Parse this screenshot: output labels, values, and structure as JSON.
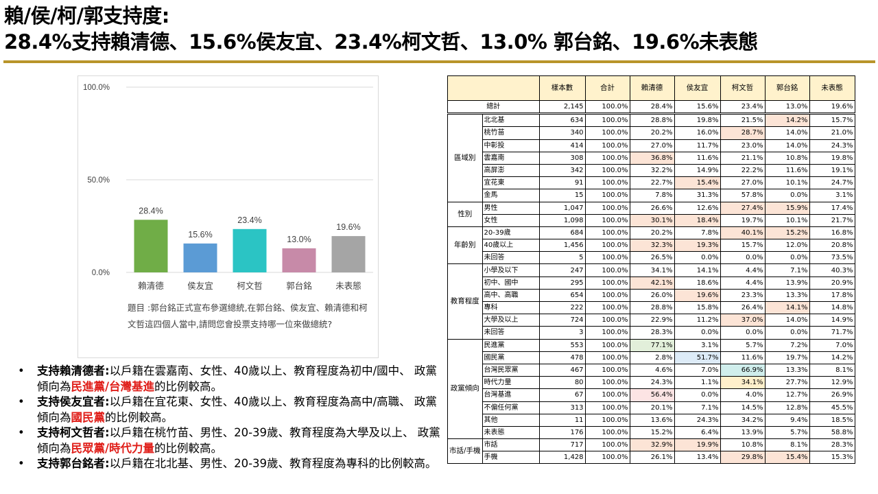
{
  "title": {
    "line1": "賴/侯/柯/郭支持度:",
    "line2": "28.4%支持賴清德、15.6%侯友宜、23.4%柯文哲、13.0% 郭台銘、19.6%未表態"
  },
  "colors": {
    "rule": "#B8942A",
    "highlight_text": "#E0201B",
    "table_header": "#FFF2CC"
  },
  "chart_data": {
    "type": "bar",
    "categories": [
      "賴清德",
      "侯友宜",
      "柯文哲",
      "郭台銘",
      "未表態"
    ],
    "values": [
      28.4,
      15.6,
      23.4,
      13.0,
      19.6
    ],
    "value_labels": [
      "28.4%",
      "15.6%",
      "23.4%",
      "13.0%",
      "19.6%"
    ],
    "bar_colors": [
      "#70AD47",
      "#5B9BD5",
      "#2BC4C4",
      "#C78AA8",
      "#A5A5A5"
    ],
    "yticks": [
      0,
      50,
      100
    ],
    "ytick_labels": [
      "0.0%",
      "50.0%",
      "100.0%"
    ],
    "ylim": [
      0,
      100
    ],
    "grid": true,
    "title": "",
    "xlabel": "",
    "ylabel": "",
    "note": "題目 :郭台銘正式宣布參選總統,在郭台銘、侯友宜、賴清德和柯文哲這四個人當中,請問您會投票支持哪一位來做總統?"
  },
  "bullets": [
    {
      "lead": "支持賴清德者:",
      "pre": "以戶籍在雲嘉南、女性、40歲以上、教育程度為初中/國中、 政黨傾向為",
      "hl": "民進黨/台灣基進",
      "post": "的比例較高。"
    },
    {
      "lead": "支持侯友宜者:",
      "pre": "以戶籍在宜花東、女性、40歲以上、教育程度為高中/高職、 政黨傾向為",
      "hl": "國民黨",
      "post": "的比例較高。"
    },
    {
      "lead": "支持柯文哲者:",
      "pre": "以戶籍在桃竹苗、男性、20-39歲、教育程度為大學及以上、 政黨傾向為",
      "hl": "民眾黨/時代力量",
      "post": "的比例較高。"
    },
    {
      "lead": "支持郭台銘者:",
      "pre": "以戶籍在北北基、男性、20-39歲、教育程度為專科的比例較高。",
      "hl": "",
      "post": ""
    }
  ],
  "table": {
    "headers": [
      "",
      "樣本數",
      "合計",
      "賴清德",
      "侯友宜",
      "柯文哲",
      "郭台銘",
      "未表態"
    ],
    "total": {
      "label": "總計",
      "values": [
        "2,145",
        "100.0%",
        "28.4%",
        "15.6%",
        "23.4%",
        "13.0%",
        "19.6%"
      ]
    },
    "groups": [
      {
        "name": "區域別",
        "rows": [
          {
            "label": "北北基",
            "values": [
              "634",
              "100.0%",
              "28.8%",
              "19.8%",
              "21.5%",
              "14.2%",
              "15.7%"
            ],
            "hl": [
              null,
              null,
              null,
              null,
              null,
              "pink",
              null
            ]
          },
          {
            "label": "桃竹苗",
            "values": [
              "340",
              "100.0%",
              "20.2%",
              "16.0%",
              "28.7%",
              "14.0%",
              "21.0%"
            ],
            "hl": [
              null,
              null,
              null,
              null,
              "pink",
              null,
              null
            ]
          },
          {
            "label": "中彰投",
            "values": [
              "414",
              "100.0%",
              "27.0%",
              "11.7%",
              "23.0%",
              "14.0%",
              "24.3%"
            ],
            "hl": [
              null,
              null,
              null,
              null,
              null,
              null,
              null
            ]
          },
          {
            "label": "雲嘉南",
            "values": [
              "308",
              "100.0%",
              "36.8%",
              "11.6%",
              "21.1%",
              "10.8%",
              "19.8%"
            ],
            "hl": [
              null,
              null,
              "pink",
              null,
              null,
              null,
              null
            ]
          },
          {
            "label": "高屏澎",
            "values": [
              "342",
              "100.0%",
              "32.2%",
              "14.9%",
              "22.2%",
              "11.6%",
              "19.1%"
            ],
            "hl": [
              null,
              null,
              null,
              null,
              null,
              null,
              null
            ]
          },
          {
            "label": "宜花東",
            "values": [
              "91",
              "100.0%",
              "22.7%",
              "15.4%",
              "27.0%",
              "10.1%",
              "24.7%"
            ],
            "hl": [
              null,
              null,
              null,
              "pink",
              null,
              null,
              null
            ]
          },
          {
            "label": "金馬",
            "values": [
              "15",
              "100.0%",
              "7.8%",
              "31.3%",
              "57.8%",
              "0.0%",
              "3.1%"
            ],
            "hl": [
              null,
              null,
              null,
              null,
              null,
              null,
              null
            ]
          }
        ]
      },
      {
        "name": "性別",
        "rows": [
          {
            "label": "男性",
            "values": [
              "1,047",
              "100.0%",
              "26.6%",
              "12.6%",
              "27.4%",
              "15.9%",
              "17.4%"
            ],
            "hl": [
              null,
              null,
              null,
              null,
              "pink",
              "pink",
              null
            ]
          },
          {
            "label": "女性",
            "values": [
              "1,098",
              "100.0%",
              "30.1%",
              "18.4%",
              "19.7%",
              "10.1%",
              "21.7%"
            ],
            "hl": [
              null,
              null,
              "pink",
              "pink",
              null,
              null,
              null
            ]
          }
        ]
      },
      {
        "name": "年齡別",
        "rows": [
          {
            "label": "20-39歲",
            "values": [
              "684",
              "100.0%",
              "20.2%",
              "7.8%",
              "40.1%",
              "15.2%",
              "16.8%"
            ],
            "hl": [
              null,
              null,
              null,
              null,
              "pink",
              "pink",
              null
            ]
          },
          {
            "label": "40歲以上",
            "values": [
              "1,456",
              "100.0%",
              "32.3%",
              "19.3%",
              "15.7%",
              "12.0%",
              "20.8%"
            ],
            "hl": [
              null,
              null,
              "pink",
              "pink",
              null,
              null,
              null
            ]
          },
          {
            "label": "未回答",
            "values": [
              "5",
              "100.0%",
              "26.5%",
              "0.0%",
              "0.0%",
              "0.0%",
              "73.5%"
            ],
            "hl": [
              null,
              null,
              null,
              null,
              null,
              null,
              null
            ]
          }
        ]
      },
      {
        "name": "教育程度",
        "rows": [
          {
            "label": "小學及以下",
            "values": [
              "247",
              "100.0%",
              "34.1%",
              "14.1%",
              "4.4%",
              "7.1%",
              "40.3%"
            ],
            "hl": [
              null,
              null,
              null,
              null,
              null,
              null,
              null
            ]
          },
          {
            "label": "初中、國中",
            "values": [
              "295",
              "100.0%",
              "42.1%",
              "18.6%",
              "4.4%",
              "13.9%",
              "20.9%"
            ],
            "hl": [
              null,
              null,
              "pink",
              null,
              null,
              null,
              null
            ]
          },
          {
            "label": "高中、高職",
            "values": [
              "654",
              "100.0%",
              "26.0%",
              "19.6%",
              "23.3%",
              "13.3%",
              "17.8%"
            ],
            "hl": [
              null,
              null,
              null,
              "pink",
              null,
              null,
              null
            ]
          },
          {
            "label": "專科",
            "values": [
              "222",
              "100.0%",
              "28.8%",
              "15.8%",
              "26.4%",
              "14.1%",
              "14.8%"
            ],
            "hl": [
              null,
              null,
              null,
              null,
              null,
              "pink",
              null
            ]
          },
          {
            "label": "大學及以上",
            "values": [
              "724",
              "100.0%",
              "22.9%",
              "11.2%",
              "37.0%",
              "14.0%",
              "14.9%"
            ],
            "hl": [
              null,
              null,
              null,
              null,
              "pink",
              null,
              null
            ]
          },
          {
            "label": "未回答",
            "values": [
              "3",
              "100.0%",
              "28.3%",
              "0.0%",
              "0.0%",
              "0.0%",
              "71.7%"
            ],
            "hl": [
              null,
              null,
              null,
              null,
              null,
              null,
              null
            ]
          }
        ]
      },
      {
        "name": "政黨傾向",
        "rows": [
          {
            "label": "民進黨",
            "values": [
              "553",
              "100.0%",
              "77.1%",
              "3.1%",
              "5.7%",
              "7.2%",
              "7.0%"
            ],
            "hl": [
              null,
              null,
              "green",
              null,
              null,
              null,
              null
            ]
          },
          {
            "label": "國民黨",
            "values": [
              "478",
              "100.0%",
              "2.8%",
              "51.7%",
              "11.6%",
              "19.7%",
              "14.2%"
            ],
            "hl": [
              null,
              null,
              null,
              "blue",
              null,
              null,
              null
            ]
          },
          {
            "label": "台灣民眾黨",
            "values": [
              "467",
              "100.0%",
              "4.6%",
              "7.0%",
              "66.9%",
              "13.3%",
              "8.1%"
            ],
            "hl": [
              null,
              null,
              null,
              null,
              "teal",
              null,
              null
            ]
          },
          {
            "label": "時代力量",
            "values": [
              "80",
              "100.0%",
              "24.3%",
              "1.1%",
              "34.1%",
              "27.7%",
              "12.9%"
            ],
            "hl": [
              null,
              null,
              null,
              null,
              "yellow",
              null,
              null
            ]
          },
          {
            "label": "台灣基進",
            "values": [
              "67",
              "100.0%",
              "56.4%",
              "0.0%",
              "4.0%",
              "12.7%",
              "26.9%"
            ],
            "hl": [
              null,
              null,
              "red",
              null,
              null,
              null,
              null
            ]
          },
          {
            "label": "不偏任何黨",
            "values": [
              "313",
              "100.0%",
              "20.1%",
              "7.1%",
              "14.5%",
              "12.8%",
              "45.5%"
            ],
            "hl": [
              null,
              null,
              null,
              null,
              null,
              null,
              null
            ]
          },
          {
            "label": "其他",
            "values": [
              "11",
              "100.0%",
              "13.6%",
              "24.3%",
              "34.2%",
              "9.4%",
              "18.5%"
            ],
            "hl": [
              null,
              null,
              null,
              null,
              null,
              null,
              null
            ]
          },
          {
            "label": "未表態",
            "values": [
              "176",
              "100.0%",
              "15.2%",
              "6.4%",
              "13.9%",
              "5.7%",
              "58.8%"
            ],
            "hl": [
              null,
              null,
              null,
              null,
              null,
              null,
              null
            ]
          }
        ]
      },
      {
        "name": "市話/手機",
        "rows": [
          {
            "label": "市話",
            "values": [
              "717",
              "100.0%",
              "32.9%",
              "19.9%",
              "10.8%",
              "8.1%",
              "28.3%"
            ],
            "hl": [
              null,
              null,
              "pink",
              "pink",
              null,
              null,
              null
            ]
          },
          {
            "label": "手機",
            "values": [
              "1,428",
              "100.0%",
              "26.1%",
              "13.4%",
              "29.8%",
              "15.4%",
              "15.3%"
            ],
            "hl": [
              null,
              null,
              null,
              null,
              "pink",
              "pink",
              null
            ]
          }
        ]
      }
    ]
  }
}
